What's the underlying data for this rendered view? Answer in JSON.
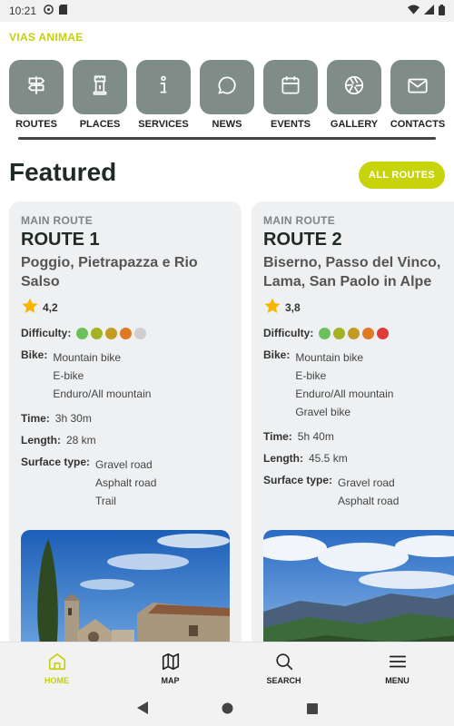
{
  "status": {
    "time": "10:21",
    "left_icons": [
      "sync-icon",
      "sd-card-icon"
    ],
    "right_icons": [
      "wifi-icon",
      "signal-icon",
      "battery-icon"
    ]
  },
  "brand": "VIAS ANIMAE",
  "categories": [
    {
      "label": "ROUTES",
      "icon": "signpost-icon"
    },
    {
      "label": "PLACES",
      "icon": "tower-icon"
    },
    {
      "label": "SERVICES",
      "icon": "info-icon"
    },
    {
      "label": "NEWS",
      "icon": "chat-icon"
    },
    {
      "label": "EVENTS",
      "icon": "calendar-icon"
    },
    {
      "label": "GALLERY",
      "icon": "aperture-icon"
    },
    {
      "label": "CONTACTS",
      "icon": "mail-icon"
    }
  ],
  "featured": {
    "title": "Featured",
    "all_routes_label": "ALL ROUTES"
  },
  "labels": {
    "difficulty": "Difficulty:",
    "bike": "Bike:",
    "time": "Time:",
    "length": "Length:",
    "surface": "Surface type:"
  },
  "routes": [
    {
      "kind": "MAIN ROUTE",
      "title": "ROUTE 1",
      "subtitle": "Poggio, Pietrapazza e Rio Salso",
      "rating": "4,2",
      "difficulty_colors": [
        "#6cc05a",
        "#a4b324",
        "#c39a22",
        "#e07a22",
        "#cfcfcf"
      ],
      "bike": [
        "Mountain bike",
        "E-bike",
        "Enduro/All mountain"
      ],
      "time": "3h 30m",
      "length": "28 km",
      "surface": [
        "Gravel road",
        "Asphalt road",
        "Trail"
      ]
    },
    {
      "kind": "MAIN ROUTE",
      "title": "ROUTE 2",
      "subtitle": "Biserno, Passo del Vinco, Lama, San Paolo in Alpe",
      "rating": "3,8",
      "difficulty_colors": [
        "#6cc05a",
        "#a4b324",
        "#c39a22",
        "#e07a22",
        "#e03a3a"
      ],
      "bike": [
        "Mountain bike",
        "E-bike",
        "Enduro/All mountain",
        "Gravel bike"
      ],
      "time": "5h 40m",
      "length": "45.5 km",
      "surface": [
        "Gravel road",
        "Asphalt road"
      ]
    }
  ],
  "bottom_nav": [
    {
      "label": "HOME",
      "icon": "home-icon",
      "active": true
    },
    {
      "label": "MAP",
      "icon": "map-icon",
      "active": false
    },
    {
      "label": "SEARCH",
      "icon": "search-icon",
      "active": false
    },
    {
      "label": "MENU",
      "icon": "menu-icon",
      "active": false
    }
  ],
  "colors": {
    "accent": "#c8d40b",
    "tile": "#7f8c87",
    "card_bg": "#eef0f2"
  }
}
